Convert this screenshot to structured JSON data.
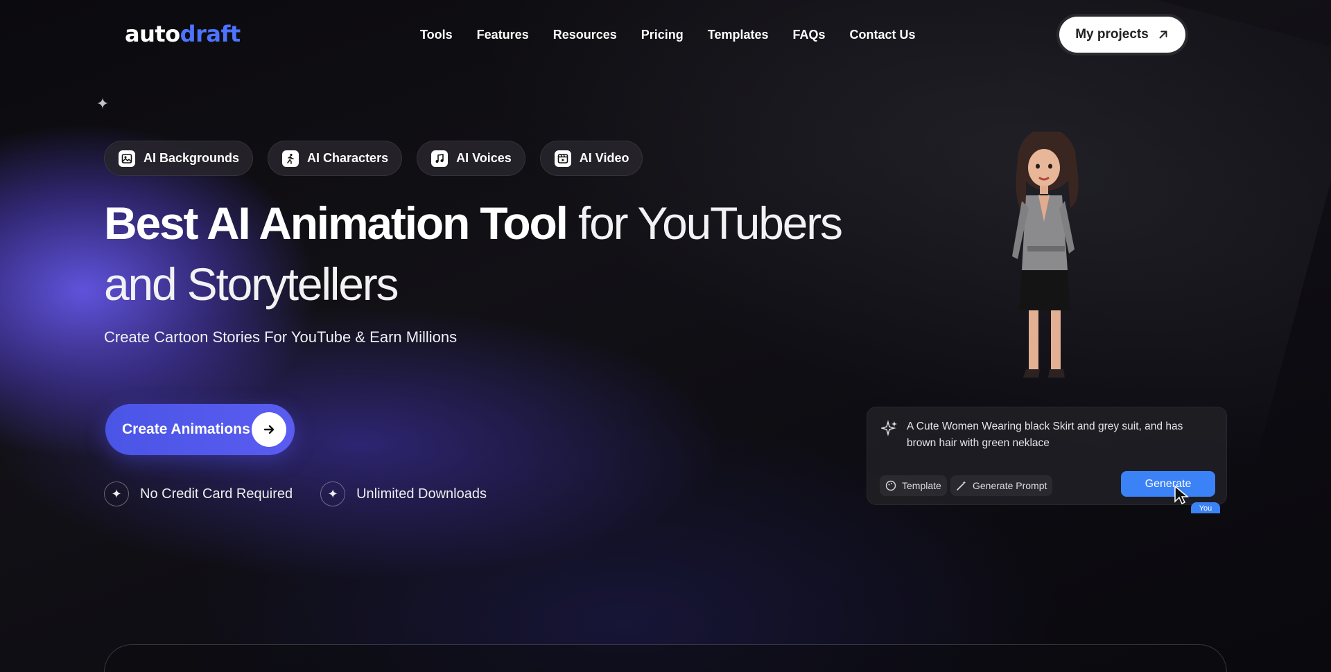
{
  "logo": {
    "part1": "auto",
    "part2": "draft"
  },
  "nav": [
    "Tools",
    "Features",
    "Resources",
    "Pricing",
    "Templates",
    "FAQs",
    "Contact Us"
  ],
  "header": {
    "my_projects": "My projects"
  },
  "pills": [
    {
      "label": "AI Backgrounds",
      "icon": "image-icon"
    },
    {
      "label": "AI Characters",
      "icon": "running-person-icon"
    },
    {
      "label": "AI Voices",
      "icon": "music-note-icon"
    },
    {
      "label": "AI Video",
      "icon": "video-icon"
    }
  ],
  "hero": {
    "title_bold": "Best AI Animation Tool",
    "title_light": " for YouTubers and Storytellers",
    "subtitle": "Create Cartoon Stories For YouTube & Earn Millions",
    "cta": "Create Animations",
    "checks": [
      "No Credit Card Required",
      "Unlimited Downloads"
    ]
  },
  "prompt_card": {
    "text": "A Cute Women Wearing black Skirt and grey suit, and has brown hair with green neklace",
    "template": "Template",
    "generate_prompt": "Generate Prompt",
    "generate": "Generate",
    "cursor_label": "You"
  },
  "colors": {
    "accent": "#4d74ff",
    "cta": "#4a55e6",
    "generate": "#3b82f6"
  }
}
